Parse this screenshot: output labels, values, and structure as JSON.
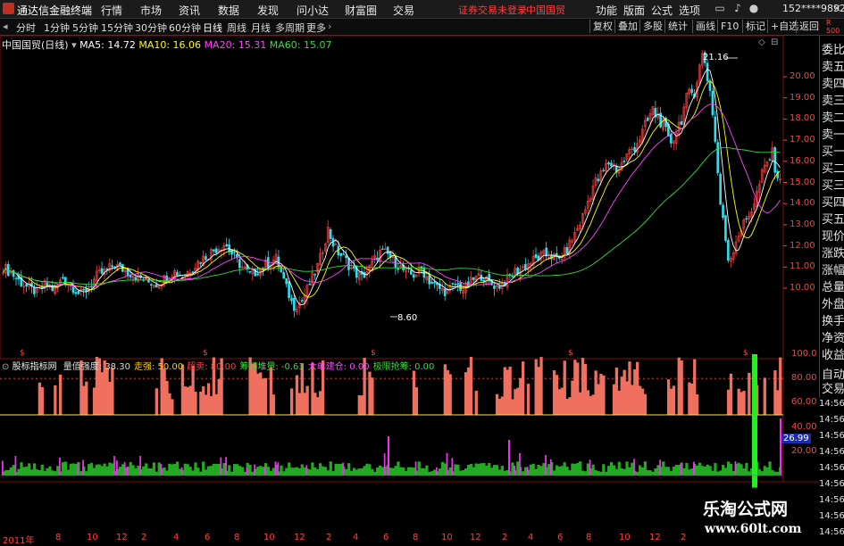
{
  "titlebar": {
    "app_name": "通达信金融终端",
    "menus": [
      "行情",
      "市场",
      "资讯",
      "数据",
      "发现",
      "问小达",
      "财富圈",
      "交易"
    ],
    "warning": "证券交易未登录",
    "stock_name": "中国国贸",
    "tools": [
      "功能",
      "版面",
      "公式",
      "选项"
    ],
    "account": "152****9892"
  },
  "periodbar": {
    "items": [
      "分时",
      "1分钟",
      "5分钟",
      "15分钟",
      "30分钟",
      "60分钟",
      "日线",
      "周线",
      "月线",
      "多周期",
      "更多"
    ],
    "selected": "日线",
    "right_buttons": [
      "复权",
      "叠加",
      "多股",
      "统计",
      "画线",
      "F10",
      "标记",
      "+自选",
      "返回"
    ]
  },
  "chart_header": {
    "title": "中国国贸(日线)",
    "ma5": "MA5: 14.72",
    "ma10": "MA10: 16.06",
    "ma20": "MA20: 15.31",
    "ma60": "MA60: 15.07"
  },
  "indicator_header": {
    "name": "股标指标网",
    "items": [
      {
        "label": "量值强度: 38.30",
        "color": "#dddddd"
      },
      {
        "label": "走强: 50.00",
        "color": "#ffcc00"
      },
      {
        "label": "超卖: 80.00",
        "color": "#ff4040"
      },
      {
        "label": "筹码堆量: -0.63",
        "color": "#33dd33"
      },
      {
        "label": "大单建仓: 0.00",
        "color": "#ff44ff"
      },
      {
        "label": "极限抢筹: 0.00",
        "color": "#33dd33"
      }
    ]
  },
  "price_axis": [
    "20.00",
    "19.00",
    "18.00",
    "17.00",
    "16.00",
    "15.00",
    "14.00",
    "13.00",
    "12.00",
    "11.00",
    "10.00"
  ],
  "indicator_axis": [
    "100.0",
    "80.00",
    "60.00",
    "40.00",
    "20.00"
  ],
  "indicator_current": "26.99",
  "high_label": "21.16",
  "low_label": "8.60",
  "sidebar": [
    "委比",
    "卖五",
    "卖四",
    "卖三",
    "卖二",
    "卖一",
    "买一",
    "买二",
    "买三",
    "买四",
    "买五",
    "现价",
    "涨跌",
    "涨幅",
    "总量",
    "外盘",
    "换手",
    "净资",
    "收益"
  ],
  "right_bottom": {
    "auto_trade": "自动交易",
    "times": [
      "14:56",
      "14:56",
      "14:56",
      "14:56",
      "14:56",
      "14:56",
      "14:56",
      "14:56",
      "14:56"
    ]
  },
  "xaxis": [
    "2011年",
    "8",
    "10",
    "12",
    "2",
    "4",
    "6",
    "8",
    "10",
    "12",
    "2",
    "4",
    "6",
    "8",
    "10",
    "12",
    "2",
    "4",
    "6",
    "8",
    "10",
    "12",
    "2"
  ],
  "watermark": {
    "cn": "乐淘公式网",
    "url": "www.60lt.com"
  },
  "colors": {
    "up": "#ff4040",
    "down": "#33ddee",
    "ma5": "#ffffff",
    "ma10": "#ffff00",
    "ma20": "#ff44ff",
    "ma60": "#33dd33"
  },
  "chart_data": {
    "type": "candlestick",
    "title": "中国国贸(日线)",
    "ylim": [
      8.5,
      21.5
    ],
    "price_trend": [
      11.0,
      10.7,
      10.3,
      10.0,
      9.8,
      10.2,
      9.9,
      10.5,
      10.1,
      9.7,
      10.0,
      10.6,
      10.8,
      11.1,
      10.9,
      10.7,
      10.5,
      10.3,
      10.2,
      10.5,
      10.8,
      10.6,
      10.9,
      11.3,
      11.6,
      11.9,
      12.1,
      11.5,
      11.0,
      10.6,
      10.9,
      11.2,
      11.4,
      10.2,
      9.1,
      9.4,
      10.3,
      11.2,
      12.8,
      11.8,
      11.4,
      10.8,
      10.5,
      11.0,
      11.7,
      11.6,
      11.2,
      10.8,
      10.6,
      10.9,
      10.3,
      10.0,
      9.8,
      10.2,
      9.9,
      10.4,
      10.6,
      10.2,
      10.1,
      10.4,
      10.8,
      11.0,
      11.3,
      11.5,
      11.6,
      11.3,
      11.8,
      12.6,
      13.5,
      14.8,
      15.3,
      16.0,
      15.6,
      16.2,
      16.8,
      17.4,
      18.4,
      18.0,
      16.8,
      17.6,
      18.8,
      19.5,
      21.16,
      18.8,
      14.0,
      11.2,
      12.5,
      13.2,
      14.1,
      15.5,
      16.4,
      14.9
    ],
    "annotations": [
      "21.16",
      "8.60"
    ],
    "indicator": {
      "name": "股标指标网",
      "values": {
        "量值强度": 38.3,
        "走强": 50.0,
        "超卖": 80.0,
        "筹码堆量": -0.63,
        "大单建仓": 0.0,
        "极限抢筹": 0.0
      },
      "ylim": [
        0,
        100
      ],
      "current": 26.99
    }
  }
}
